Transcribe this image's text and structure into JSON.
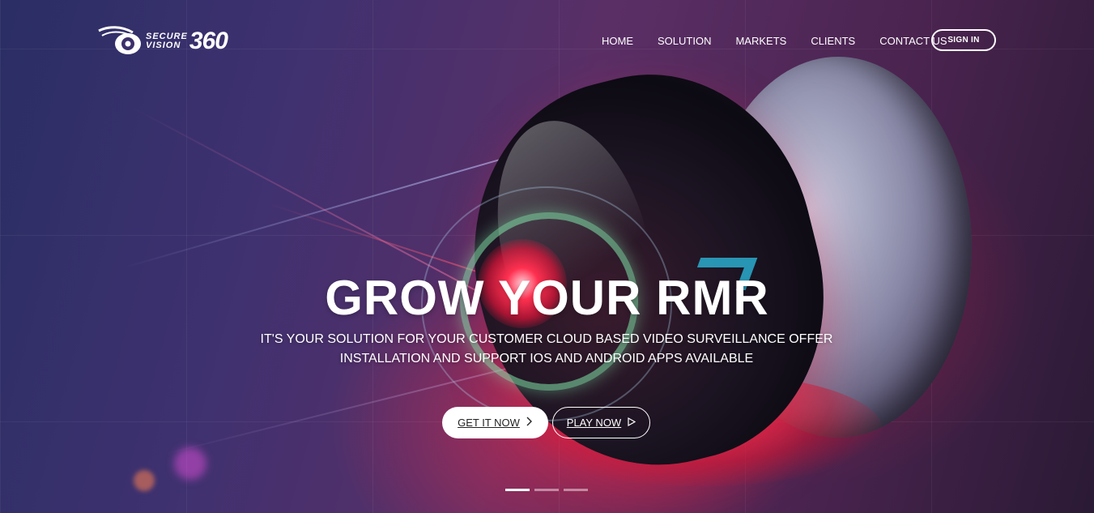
{
  "brand": {
    "logo_top": "SECURE",
    "logo_bottom": "VISION",
    "logo_number": "360"
  },
  "nav": {
    "items": [
      {
        "label": "HOME"
      },
      {
        "label": "SOLUTION"
      },
      {
        "label": "MARKETS"
      },
      {
        "label": "CLIENTS"
      },
      {
        "label": "CONTACT US"
      }
    ],
    "signin_label": "SIGN IN"
  },
  "hero": {
    "headline": "GROW YOUR RMR",
    "subline": "IT'S YOUR SOLUTION FOR YOUR CUSTOMER CLOUD BASED VIDEO SURVEILLANCE OFFER INSTALLATION AND SUPPORT IOS AND ANDROID APPS AVAILABLE",
    "primary_button": "GET IT NOW",
    "secondary_button": "PLAY NOW",
    "primary_icon": "chevron-right-icon",
    "secondary_icon": "play-icon"
  },
  "slider": {
    "total_slides": 3,
    "active_slide": 1
  }
}
